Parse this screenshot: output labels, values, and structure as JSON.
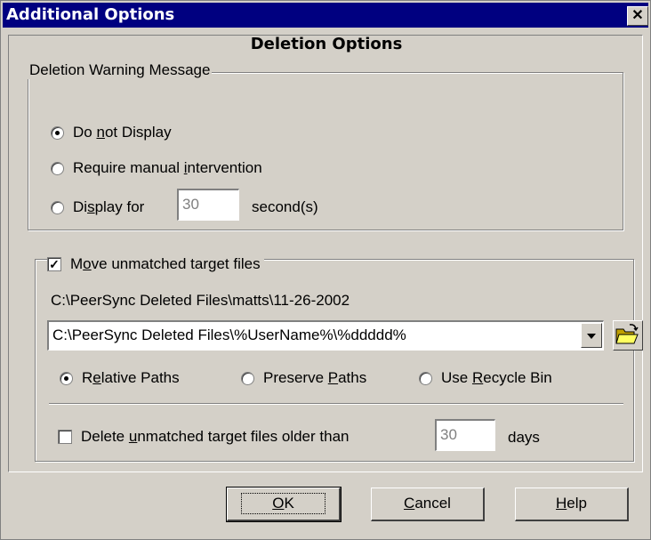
{
  "window": {
    "title": "Additional Options"
  },
  "heading": "Deletion Options",
  "warning_group": {
    "legend": "Deletion Warning Message",
    "options": [
      {
        "pre": "Do ",
        "ul": "n",
        "post": "ot Display",
        "selected": true
      },
      {
        "pre": "Require manual ",
        "ul": "i",
        "post": "ntervention",
        "selected": false
      },
      {
        "pre": "Di",
        "ul": "s",
        "post": "play for",
        "selected": false
      }
    ],
    "seconds_value": "30",
    "seconds_label": "second(s)"
  },
  "move_group": {
    "checkbox": {
      "pre": "M",
      "ul": "o",
      "post": "ve unmatched target files",
      "checked": true
    },
    "resolved_path": "C:\\PeerSync Deleted Files\\matts\\11-26-2002",
    "path_template": "C:\\PeerSync Deleted Files\\%UserName%\\%ddddd%",
    "path_options": [
      {
        "pre": "R",
        "ul": "e",
        "post": "lative Paths",
        "selected": true
      },
      {
        "pre": "Preserve ",
        "ul": "P",
        "post": "aths",
        "selected": false
      },
      {
        "pre": "Use ",
        "ul": "R",
        "post": "ecycle Bin",
        "selected": false
      }
    ],
    "delete_older": {
      "pre": "Delete ",
      "ul": "u",
      "post": "nmatched target files older than",
      "checked": false,
      "days_value": "30",
      "days_label": "days"
    }
  },
  "buttons": {
    "ok": {
      "ul": "O",
      "post": "K"
    },
    "cancel": {
      "ul": "C",
      "post": "ancel"
    },
    "help": {
      "ul": "H",
      "post": "elp"
    }
  }
}
